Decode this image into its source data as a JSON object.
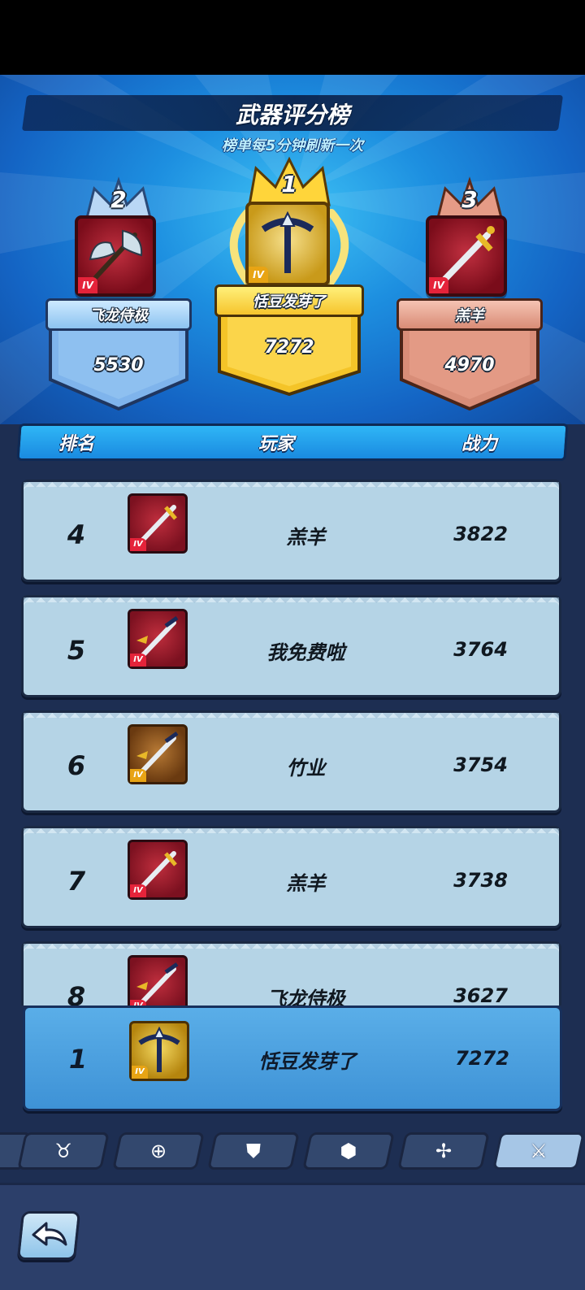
{
  "header": {
    "title": "武器评分榜",
    "subtitle": "榜单每5分钟刷新一次"
  },
  "podium": [
    {
      "rank": "2",
      "name": "飞龙侍极",
      "score": "5530",
      "tier": "IV",
      "color": "#9ccff5"
    },
    {
      "rank": "1",
      "name": "恬豆发芽了",
      "score": "7272",
      "tier": "IV",
      "color": "#ffd53a"
    },
    {
      "rank": "3",
      "name": "羔羊",
      "score": "4970",
      "tier": "IV",
      "color": "#e59b86"
    }
  ],
  "table": {
    "col_rank": "排名",
    "col_player": "玩家",
    "col_power": "战力",
    "rows": [
      {
        "rank": "4",
        "name": "羔羊",
        "power": "3822",
        "tier": "IV",
        "icon": "golden-dagger-icon"
      },
      {
        "rank": "5",
        "name": "我免费啦",
        "power": "3764",
        "tier": "IV",
        "icon": "winged-sword-icon"
      },
      {
        "rank": "6",
        "name": "竹业",
        "power": "3754",
        "tier": "IV",
        "icon": "winged-sword-icon"
      },
      {
        "rank": "7",
        "name": "羔羊",
        "power": "3738",
        "tier": "IV",
        "icon": "golden-dagger-icon"
      },
      {
        "rank": "8",
        "name": "飞龙侍极",
        "power": "3627",
        "tier": "IV",
        "icon": "winged-sword-icon"
      }
    ]
  },
  "self": {
    "rank": "1",
    "name": "恬豆发芽了",
    "power": "7272",
    "tier": "IV",
    "icon": "crossbow-icon"
  },
  "tabs": [
    {
      "icon": "horned-demon-icon",
      "active": false
    },
    {
      "icon": "gem-badge-icon",
      "active": false
    },
    {
      "icon": "armor-icon",
      "active": false
    },
    {
      "icon": "helmet-icon",
      "active": false
    },
    {
      "icon": "compass-icon",
      "active": false
    },
    {
      "icon": "sword-icon",
      "active": true
    }
  ],
  "colors": {
    "accent_blue": "#1a8ae0",
    "gold": "#ffd53a",
    "row_bg": "#b5d4e6",
    "self_row_bg": "#4a9fe0"
  }
}
